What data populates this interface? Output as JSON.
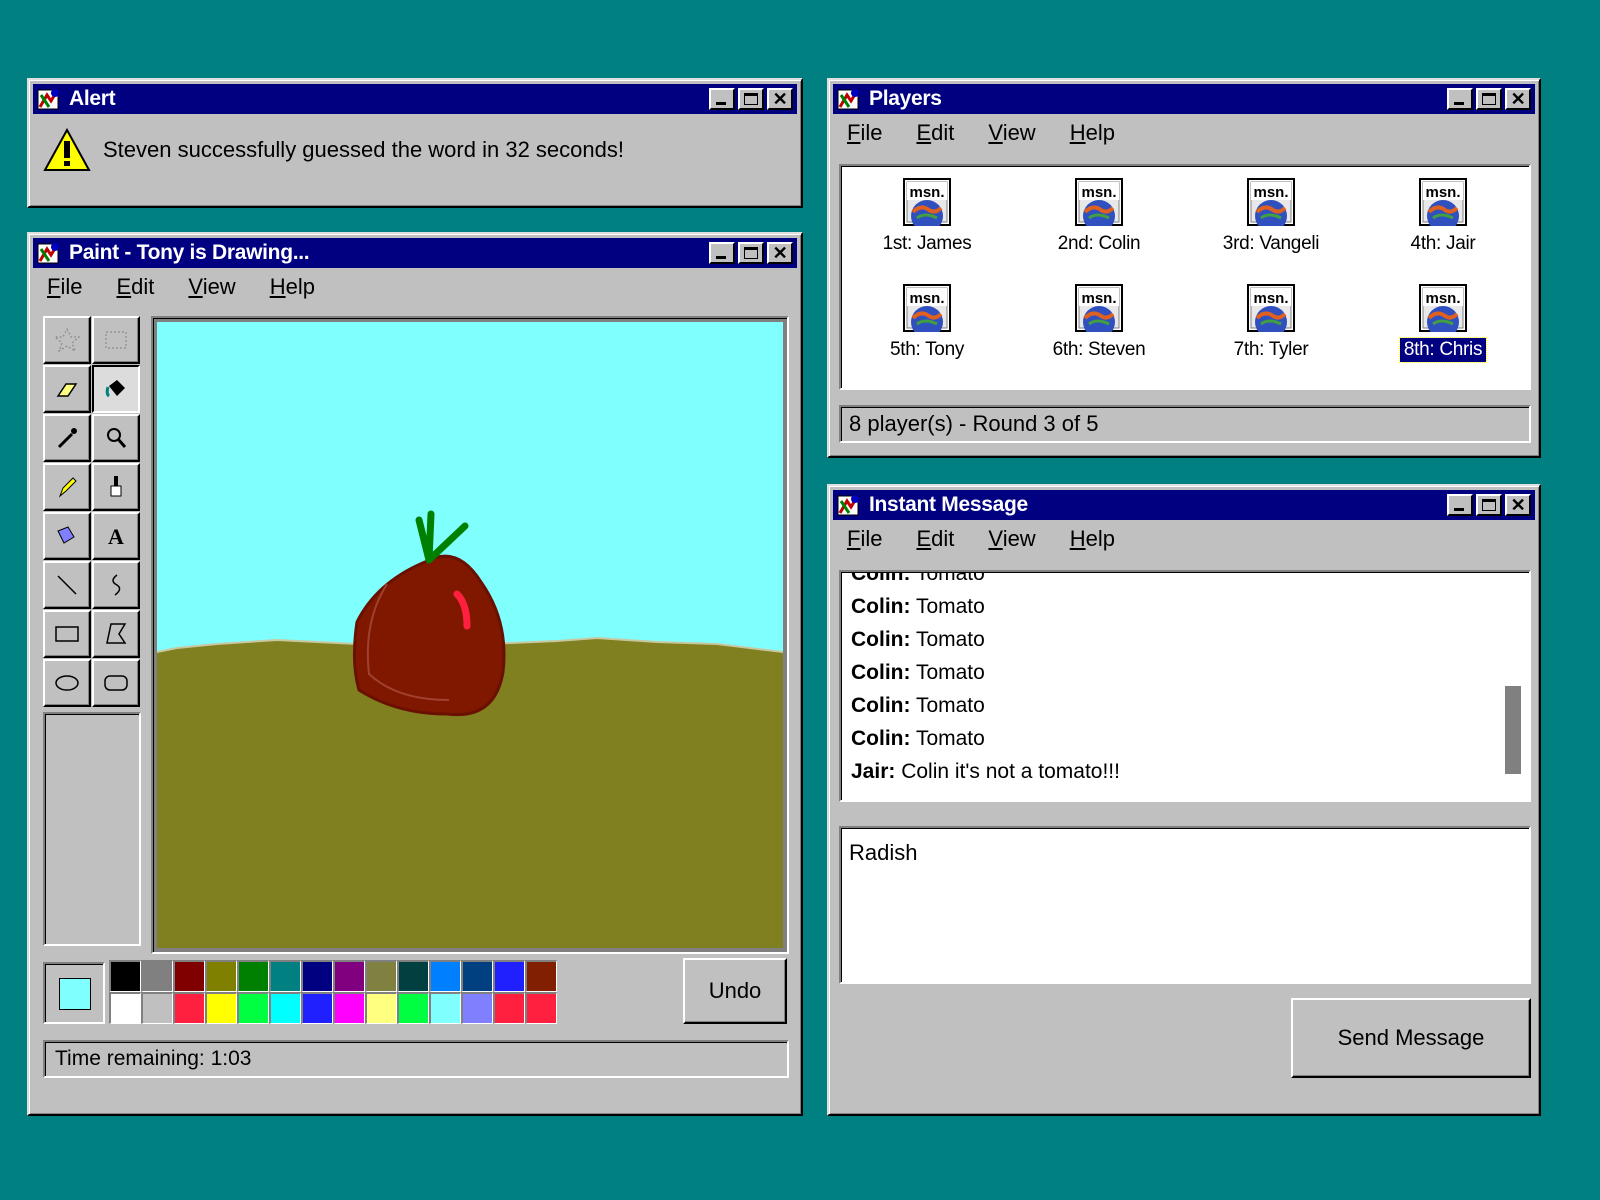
{
  "colors": {
    "desktop": "#008080",
    "titlebar": "#000080",
    "sky": "#80ffff",
    "ground": "#808020",
    "radish": "#801800",
    "leaves": "#008000",
    "highlight": "#ff2020"
  },
  "menu": {
    "file": "File",
    "edit": "Edit",
    "view": "View",
    "help": "Help"
  },
  "alert": {
    "title": "Alert",
    "icon": "warning-icon",
    "message": "Steven successfully guessed the word in 32 seconds!"
  },
  "paint": {
    "title": "Paint - Tony is Drawing...",
    "tools": [
      "free-select-icon",
      "rect-select-icon",
      "eraser-icon",
      "fill-bucket-icon",
      "eyedropper-icon",
      "magnifier-icon",
      "pencil-icon",
      "brush-icon",
      "airbrush-icon",
      "text-icon",
      "line-icon",
      "curve-icon",
      "rectangle-icon",
      "polygon-icon",
      "ellipse-icon",
      "rounded-rect-icon"
    ],
    "selected_tool": "fill-bucket-icon",
    "current_color": "#80ffff",
    "palette": [
      "#000000",
      "#808080",
      "#800000",
      "#808000",
      "#008000",
      "#008080",
      "#000080",
      "#800080",
      "#808040",
      "#004040",
      "#0080ff",
      "#004080",
      "#2020ff",
      "#802000",
      "#ffffff",
      "#c0c0c0",
      "#ff2040",
      "#ffff00",
      "#00ff40",
      "#00ffff",
      "#2020ff",
      "#ff00ff",
      "#ffff80",
      "#00ff40",
      "#80ffff",
      "#8080ff",
      "#ff2040",
      "#ff2040"
    ],
    "undo_label": "Undo",
    "status": "Time remaining: 1:03"
  },
  "players": {
    "title": "Players",
    "list": [
      {
        "label": "1st: James"
      },
      {
        "label": "2nd: Colin"
      },
      {
        "label": "3rd: Vangeli"
      },
      {
        "label": "4th: Jair"
      },
      {
        "label": "5th: Tony"
      },
      {
        "label": "6th: Steven"
      },
      {
        "label": "7th: Tyler"
      },
      {
        "label": "8th: Chris"
      }
    ],
    "selected": "8th: Chris",
    "icon_text": "msn.",
    "status": "8 player(s) - Round 3 of 5"
  },
  "im": {
    "title": "Instant Message",
    "messages": [
      {
        "sender": "Colin:",
        "text": " Tomato"
      },
      {
        "sender": "Colin:",
        "text": " Tomato"
      },
      {
        "sender": "Colin:",
        "text": " Tomato"
      },
      {
        "sender": "Colin:",
        "text": " Tomato"
      },
      {
        "sender": "Colin:",
        "text": " Tomato"
      },
      {
        "sender": "Colin:",
        "text": " Tomato"
      },
      {
        "sender": "Jair:",
        "text": " Colin it's not a tomato!!!"
      }
    ],
    "compose_value": "Radish",
    "send_label": "Send Message"
  }
}
